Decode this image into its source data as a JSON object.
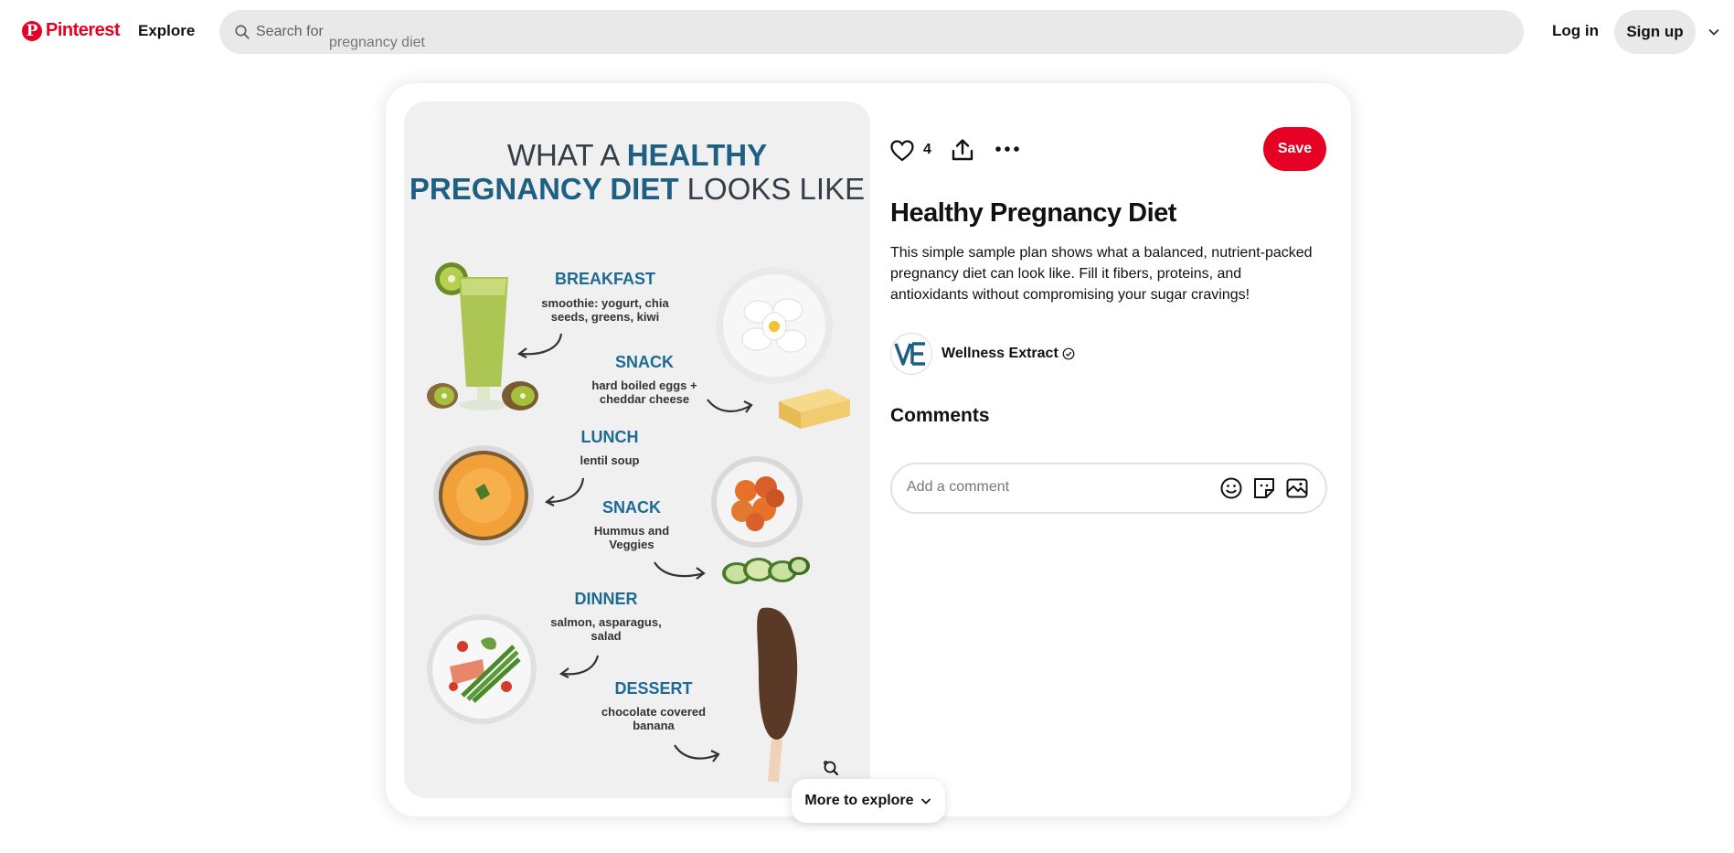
{
  "header": {
    "logo_text": "Pinterest",
    "explore_label": "Explore",
    "search_label": "Search for",
    "search_suggestion": "pregnancy diet",
    "login_label": "Log in",
    "signup_label": "Sign up"
  },
  "pin": {
    "like_count": "4",
    "save_label": "Save",
    "title": "Healthy Pregnancy Diet",
    "description": "This simple sample plan shows what a balanced, nutrient-packed pregnancy diet can look like. Fill it fibers, proteins, and antioxidants without compromising your sugar cravings!",
    "creator_name": "Wellness Extract",
    "image": {
      "title_part1": "WHAT A ",
      "title_part2": "HEALTHY",
      "title_part3": "PREGNANCY DIET",
      "title_part4": " LOOKS LIKE",
      "meals": [
        {
          "name": "BREAKFAST",
          "desc1": "smoothie: yogurt, chia",
          "desc2": "seeds, greens, kiwi"
        },
        {
          "name": "SNACK",
          "desc1": "hard boiled eggs +",
          "desc2": "cheddar cheese"
        },
        {
          "name": "LUNCH",
          "desc1": "lentil soup",
          "desc2": ""
        },
        {
          "name": "SNACK",
          "desc1": "Hummus and",
          "desc2": "Veggies"
        },
        {
          "name": "DINNER",
          "desc1": "salmon, asparagus,",
          "desc2": "salad"
        },
        {
          "name": "DESSERT",
          "desc1": "chocolate covered",
          "desc2": "banana"
        }
      ]
    }
  },
  "comments": {
    "heading": "Comments",
    "placeholder": "Add a comment"
  },
  "more_to_explore": "More to explore",
  "colors": {
    "brand_red": "#e60023",
    "pin_blue": "#1e6a93"
  }
}
